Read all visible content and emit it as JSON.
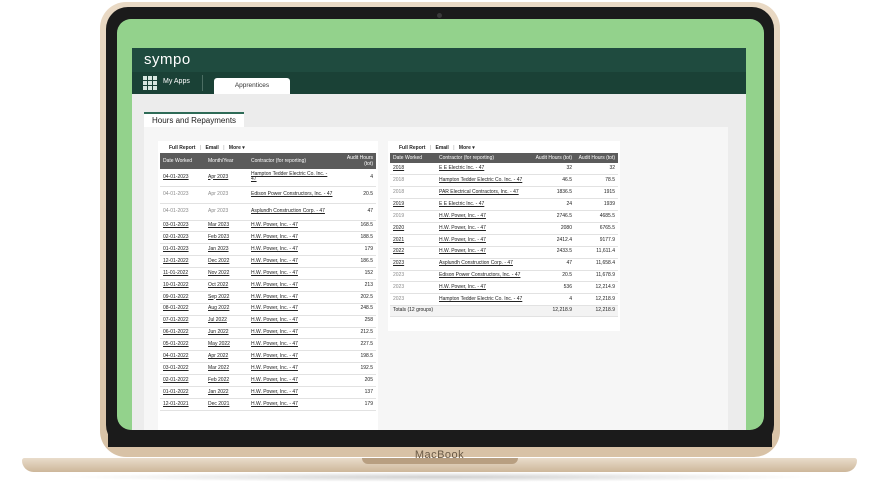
{
  "device": {
    "brand": "MacBook"
  },
  "app": {
    "logo": "sympo",
    "nav": {
      "my_apps": "My Apps",
      "tab": "Apprentices"
    },
    "page_tab": "Hours and Repayments"
  },
  "toolbar": {
    "full_report": "Full Report",
    "sep": "|",
    "email": "Email",
    "more": "More ▾"
  },
  "left_table": {
    "headers": [
      "Date Worked",
      "Month/Year",
      "Contractor (for reporting)",
      "Audit Hours (tot)"
    ],
    "rows": [
      {
        "date": "04-01-2023",
        "month": "Apr 2023",
        "contractor": "Hampton Tedder Electric Co. Inc. - 47",
        "hours": "4",
        "muted": false,
        "tall": true
      },
      {
        "date": "04-01-2023",
        "month": "Apr 2023",
        "contractor": "Edison Power Constructors, Inc. - 47",
        "hours": "20.5",
        "muted": true,
        "tall": true
      },
      {
        "date": "04-01-2023",
        "month": "Apr 2023",
        "contractor": "Asplundh Construction Corp. - 47",
        "hours": "47",
        "muted": true,
        "tall": true
      },
      {
        "date": "03-01-2023",
        "month": "Mar 2023",
        "contractor": "H.W. Power, Inc. - 47",
        "hours": "168.5",
        "muted": false,
        "tall": false
      },
      {
        "date": "02-01-2023",
        "month": "Feb 2023",
        "contractor": "H.W. Power, Inc. - 47",
        "hours": "188.5",
        "muted": false,
        "tall": false
      },
      {
        "date": "01-01-2023",
        "month": "Jan 2023",
        "contractor": "H.W. Power, Inc. - 47",
        "hours": "179",
        "muted": false,
        "tall": false
      },
      {
        "date": "12-01-2022",
        "month": "Dec 2022",
        "contractor": "H.W. Power, Inc. - 47",
        "hours": "186.5",
        "muted": false,
        "tall": false
      },
      {
        "date": "11-01-2022",
        "month": "Nov 2022",
        "contractor": "H.W. Power, Inc. - 47",
        "hours": "152",
        "muted": false,
        "tall": false
      },
      {
        "date": "10-01-2022",
        "month": "Oct 2022",
        "contractor": "H.W. Power, Inc. - 47",
        "hours": "213",
        "muted": false,
        "tall": false
      },
      {
        "date": "09-01-2022",
        "month": "Sep 2022",
        "contractor": "H.W. Power, Inc. - 47",
        "hours": "202.5",
        "muted": false,
        "tall": false
      },
      {
        "date": "08-01-2022",
        "month": "Aug 2022",
        "contractor": "H.W. Power, Inc. - 47",
        "hours": "248.5",
        "muted": false,
        "tall": false
      },
      {
        "date": "07-01-2022",
        "month": "Jul 2022",
        "contractor": "H.W. Power, Inc. - 47",
        "hours": "258",
        "muted": false,
        "tall": false
      },
      {
        "date": "06-01-2022",
        "month": "Jun 2022",
        "contractor": "H.W. Power, Inc. - 47",
        "hours": "212.5",
        "muted": false,
        "tall": false
      },
      {
        "date": "05-01-2022",
        "month": "May 2022",
        "contractor": "H.W. Power, Inc. - 47",
        "hours": "227.5",
        "muted": false,
        "tall": false
      },
      {
        "date": "04-01-2022",
        "month": "Apr 2022",
        "contractor": "H.W. Power, Inc. - 47",
        "hours": "198.5",
        "muted": false,
        "tall": false
      },
      {
        "date": "03-01-2022",
        "month": "Mar 2022",
        "contractor": "H.W. Power, Inc. - 47",
        "hours": "192.5",
        "muted": false,
        "tall": false
      },
      {
        "date": "02-01-2022",
        "month": "Feb 2022",
        "contractor": "H.W. Power, Inc. - 47",
        "hours": "205",
        "muted": false,
        "tall": false
      },
      {
        "date": "01-01-2022",
        "month": "Jan 2022",
        "contractor": "H.W. Power, Inc. - 47",
        "hours": "137",
        "muted": false,
        "tall": false
      },
      {
        "date": "12-01-2021",
        "month": "Dec 2021",
        "contractor": "H.W. Power, Inc. - 47",
        "hours": "179",
        "muted": false,
        "tall": false
      }
    ]
  },
  "right_table": {
    "headers": [
      "Date Worked",
      "Contractor (for reporting)",
      "Audit Hours (tot)",
      "Audit Hours (tot)"
    ],
    "rows": [
      {
        "year": "2018",
        "contractor": "E E Electric Inc. - 47",
        "hours": "32",
        "cumulative": "32",
        "muted": false
      },
      {
        "year": "2018",
        "contractor": "Hampton Tedder Electric Co. Inc. - 47",
        "hours": "46.5",
        "cumulative": "78.5",
        "muted": true
      },
      {
        "year": "2018",
        "contractor": "PAR Electrical Contractors, Inc. - 47",
        "hours": "1836.5",
        "cumulative": "1915",
        "muted": true
      },
      {
        "year": "2019",
        "contractor": "E E Electric Inc. - 47",
        "hours": "24",
        "cumulative": "1939",
        "muted": false
      },
      {
        "year": "2019",
        "contractor": "H.W. Power, Inc. - 47",
        "hours": "2746.5",
        "cumulative": "4685.5",
        "muted": true
      },
      {
        "year": "2020",
        "contractor": "H.W. Power, Inc. - 47",
        "hours": "2080",
        "cumulative": "6765.5",
        "muted": false
      },
      {
        "year": "2021",
        "contractor": "H.W. Power, Inc. - 47",
        "hours": "2412.4",
        "cumulative": "9177.9",
        "muted": false
      },
      {
        "year": "2022",
        "contractor": "H.W. Power, Inc. - 47",
        "hours": "2433.5",
        "cumulative": "11,611.4",
        "muted": false
      },
      {
        "year": "2023",
        "contractor": "Asplundh Construction Corp. - 47",
        "hours": "47",
        "cumulative": "11,658.4",
        "muted": false
      },
      {
        "year": "2023",
        "contractor": "Edison Power Constructors, Inc. - 47",
        "hours": "20.5",
        "cumulative": "11,678.9",
        "muted": true
      },
      {
        "year": "2023",
        "contractor": "H.W. Power, Inc. - 47",
        "hours": "536",
        "cumulative": "12,214.9",
        "muted": true
      },
      {
        "year": "2023",
        "contractor": "Hampton Tedder Electric Co. Inc. - 47",
        "hours": "4",
        "cumulative": "12,218.9",
        "muted": true
      }
    ],
    "totals": {
      "label": "Totals (12 groups)",
      "hours": "12,218.9",
      "cumulative": "12,218.9"
    }
  }
}
